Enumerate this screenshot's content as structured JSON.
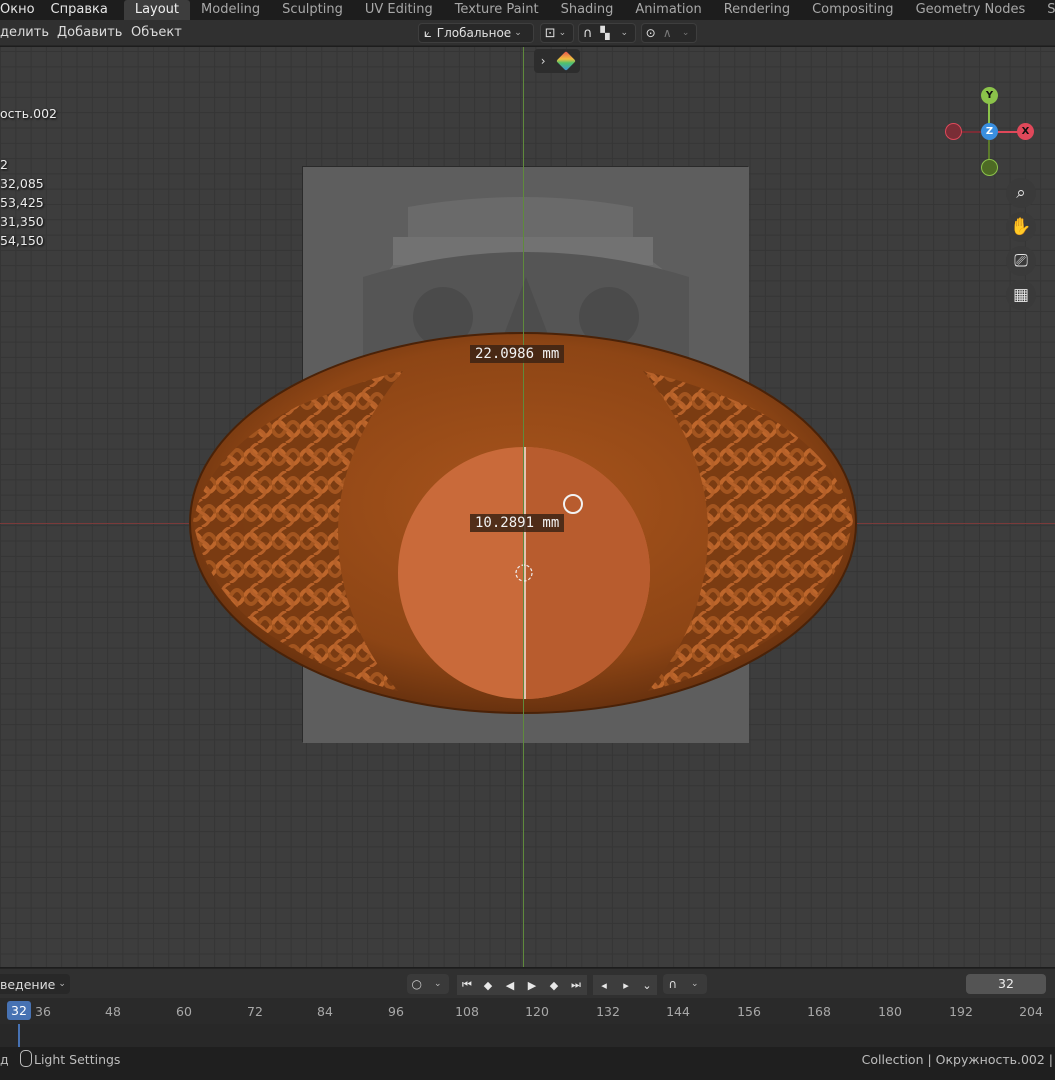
{
  "topbar": {
    "menus": [
      "Окно",
      "Справка"
    ],
    "workspaces": [
      "Layout",
      "Modeling",
      "Sculpting",
      "UV Editing",
      "Texture Paint",
      "Shading",
      "Animation",
      "Rendering",
      "Compositing",
      "Geometry Nodes",
      "Scripting"
    ],
    "active_workspace": "Layout"
  },
  "header": {
    "menus": [
      "делить",
      "Добавить",
      "Объект"
    ],
    "orientation": "Глобальное"
  },
  "viewport": {
    "object_name": "ость.002",
    "stats": [
      "2",
      "32,085",
      "53,425",
      "31,350",
      "54,150"
    ],
    "measure_width": "22.0986 mm",
    "measure_radius": "10.2891 mm",
    "gizmo": {
      "x": "X",
      "y": "Y",
      "z": "Z"
    },
    "colors": {
      "ring": "#b05a22",
      "disc": "#c96a3a",
      "axis_x": "#e0485a",
      "axis_y": "#8bc34a",
      "axis_z": "#3a8fe0"
    },
    "nav_icons": [
      "zoom-icon",
      "hand-pan-icon",
      "camera-icon",
      "grid-icon"
    ]
  },
  "timeline": {
    "mode_label": "ведение",
    "current_frame": "32",
    "ruler": [
      "32",
      "36",
      "48",
      "60",
      "72",
      "84",
      "96",
      "108",
      "120",
      "132",
      "144",
      "156",
      "168",
      "180",
      "192",
      "204"
    ]
  },
  "statusbar": {
    "left_text": "Light Settings",
    "left_char": "д",
    "right_text": "Collection | Окружность.002 |"
  }
}
